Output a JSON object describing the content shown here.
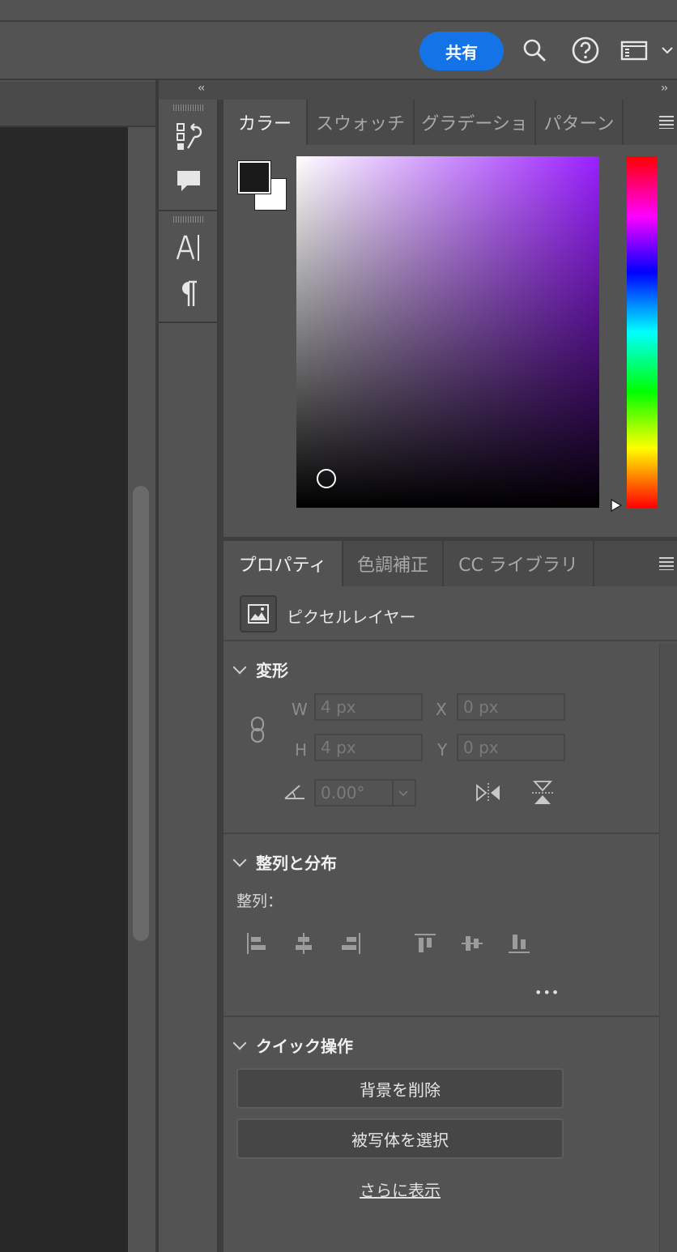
{
  "header": {
    "share_label": "共有",
    "icons": [
      "search-icon",
      "help-icon",
      "workspace-icon",
      "chevron-down-icon"
    ]
  },
  "color_panel": {
    "tabs": [
      {
        "label": "カラー",
        "active": true
      },
      {
        "label": "スウォッチ",
        "active": false
      },
      {
        "label": "グラデーショ",
        "active": false
      },
      {
        "label": "パターン",
        "active": false
      }
    ],
    "foreground_color": "#1a1a1a",
    "background_color": "#ffffff",
    "hue_color": "#9a1fff"
  },
  "properties_panel": {
    "tabs": [
      {
        "label": "プロパティ",
        "active": true
      },
      {
        "label": "色調補正",
        "active": false
      },
      {
        "label": "CC ライブラリ",
        "active": false
      }
    ],
    "layer_type": "ピクセルレイヤー",
    "transform": {
      "title": "変形",
      "w_label": "W",
      "w_value": "4 px",
      "h_label": "H",
      "h_value": "4 px",
      "x_label": "X",
      "x_value": "0 px",
      "y_label": "Y",
      "y_value": "0 px",
      "angle_value": "0.00°"
    },
    "align": {
      "title": "整列と分布",
      "sub_label": "整列：",
      "more": "•••"
    },
    "quick": {
      "title": "クイック操作",
      "remove_bg": "背景を削除",
      "select_subject": "被写体を選択",
      "show_more": "さらに表示"
    }
  },
  "collapse": {
    "left": "‹‹",
    "right": "››"
  }
}
